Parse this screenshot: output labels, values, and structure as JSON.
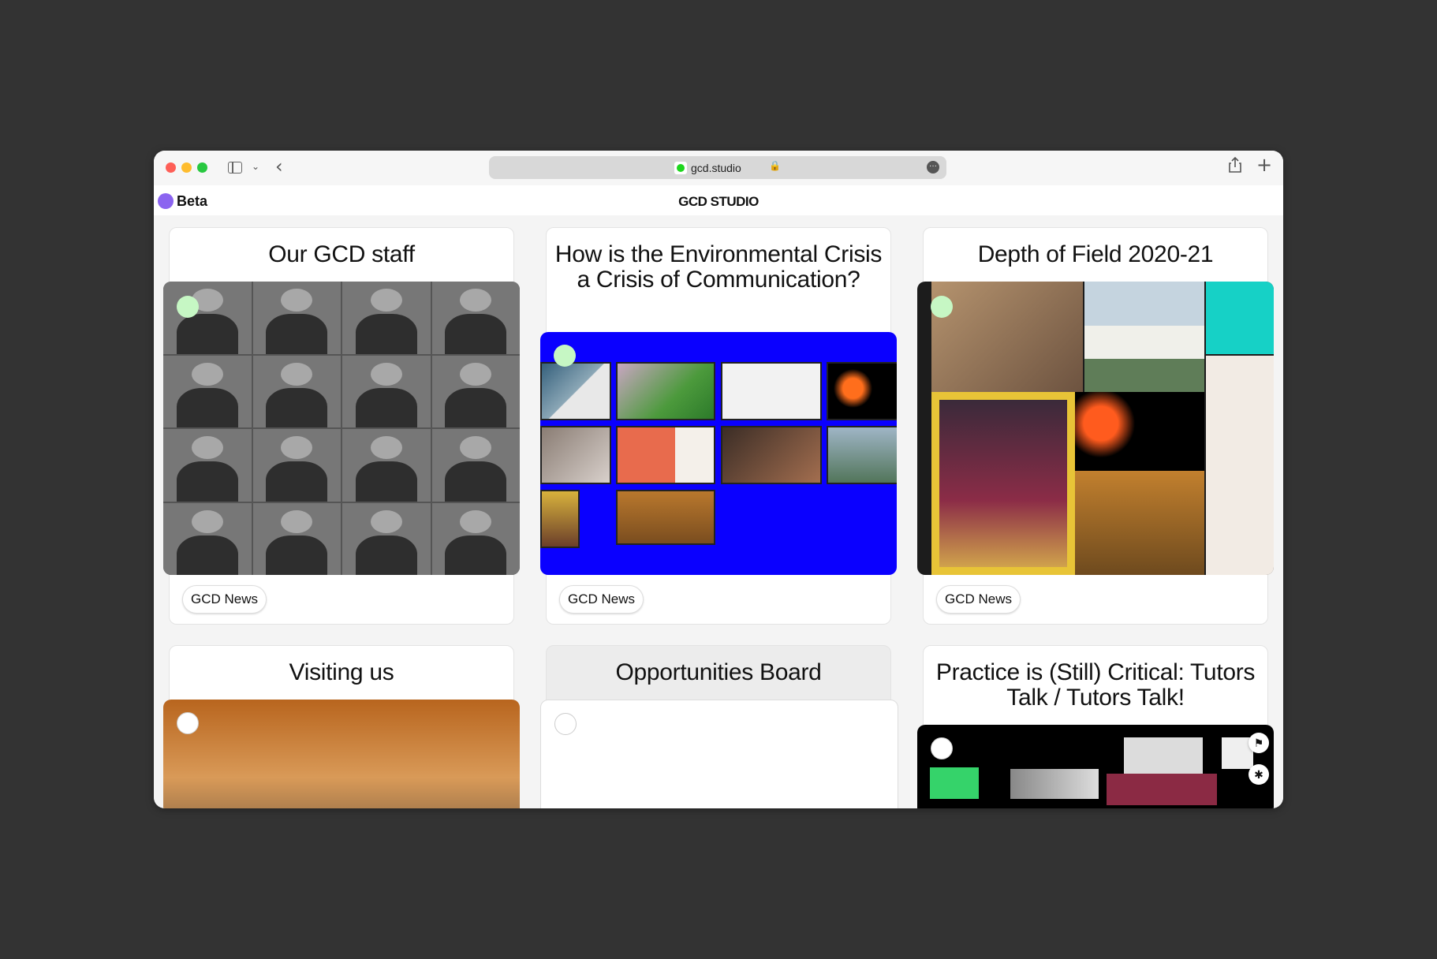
{
  "browser": {
    "url": "gcd.studio"
  },
  "app": {
    "badge": "Beta",
    "title": "GCD STUDIO"
  },
  "cards": [
    {
      "title": "Our GCD staff",
      "tag": "GCD News"
    },
    {
      "title": "How is the Environmental Crisis a Crisis of Communication?",
      "tag": "GCD News"
    },
    {
      "title": "Depth of Field 2020-21",
      "tag": "GCD News"
    },
    {
      "title": "Visiting us"
    },
    {
      "title": "Opportunities Board"
    },
    {
      "title": "Practice is (Still) Critical: Tutors Talk / Tutors Talk!"
    }
  ],
  "colors": {
    "page_background": "#333333",
    "beta_dot": "#8b64f0",
    "status_dot": "#c6f7c4",
    "env_card_background": "#0a00ff"
  },
  "icons": {
    "share": "share-icon",
    "new_tab": "plus-icon",
    "flag": "flag-icon",
    "bug": "bug-icon"
  }
}
